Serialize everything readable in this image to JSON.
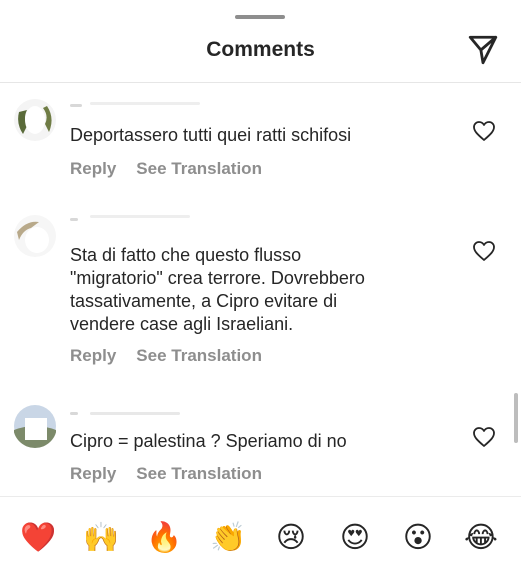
{
  "header": {
    "title": "Comments",
    "send_icon": "paper-plane-icon"
  },
  "comments": [
    {
      "text": "Deportassero tutti quei ratti schifosi",
      "reply_label": "Reply",
      "translate_label": "See Translation"
    },
    {
      "text": "Sta di fatto che questo flusso\n\"migratorio\" crea terrore. Dovrebbero\ntassativamente, a Cipro evitare di\nvendere case agli Israeliani.",
      "reply_label": "Reply",
      "translate_label": "See Translation"
    },
    {
      "text": "Cipro = palestina ? Speriamo di no",
      "reply_label": "Reply",
      "translate_label": "See Translation"
    }
  ],
  "reactions": [
    "❤️",
    "🙌",
    "🔥",
    "👏",
    "😢",
    "😍",
    "😮",
    "😂"
  ],
  "colors": {
    "text": "#262626",
    "secondary": "#8e8e8e",
    "heart_red": "#ed4956",
    "divider": "#e6e6e6"
  }
}
